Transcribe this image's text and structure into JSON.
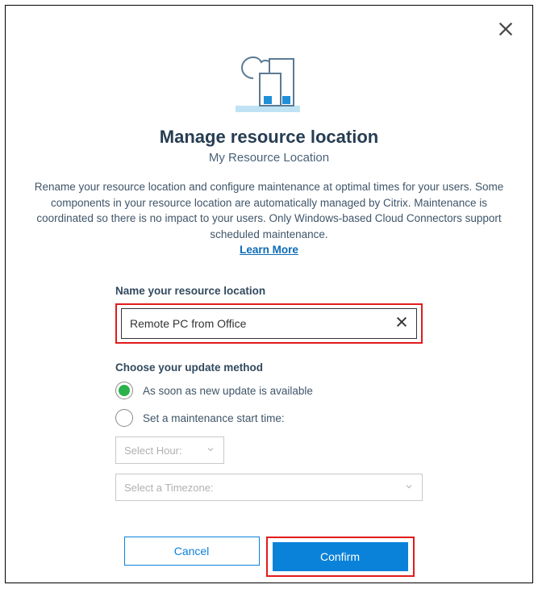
{
  "dialog": {
    "title": "Manage resource location",
    "subtitle": "My Resource Location",
    "description": "Rename your resource location and configure maintenance at optimal times for your users. Some components in your resource location are automatically managed by Citrix. Maintenance is coordinated so there is no impact to your users. Only Windows-based Cloud Connectors support scheduled maintenance.",
    "learn_more_label": "Learn More"
  },
  "form": {
    "name_label": "Name your resource location",
    "name_value": "Remote PC from Office",
    "method_label": "Choose your update method",
    "options": {
      "immediate": "As soon as new update is available",
      "scheduled": "Set a maintenance start time:"
    },
    "select_hour_placeholder": "Select Hour:",
    "select_timezone_placeholder": "Select a Timezone:"
  },
  "buttons": {
    "cancel": "Cancel",
    "confirm": "Confirm"
  }
}
